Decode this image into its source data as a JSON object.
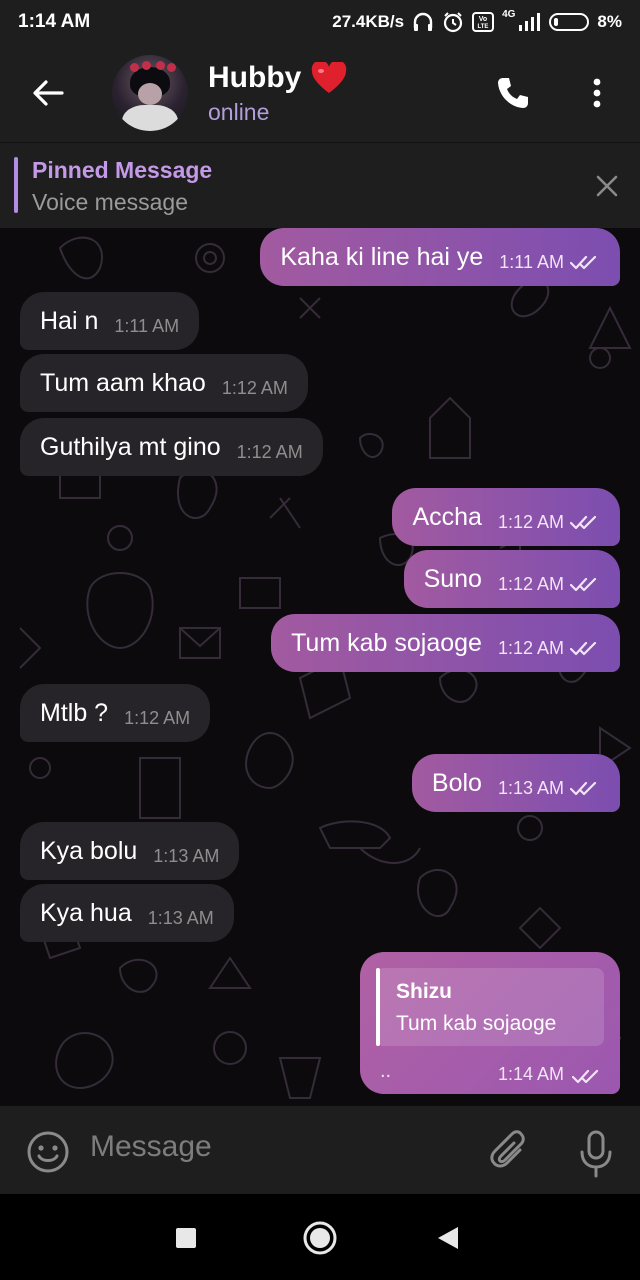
{
  "status_bar": {
    "time": "1:14 AM",
    "speed": "27.4KB/s",
    "battery": "8%",
    "network": "4G"
  },
  "header": {
    "title": "Hubby",
    "status": "online",
    "accent": "#b39ddb"
  },
  "pinned": {
    "label": "Pinned Message",
    "text": "Voice message"
  },
  "messages": [
    {
      "dir": "out",
      "text": "Kaha ki line hai ye",
      "time": "1:11 AM"
    },
    {
      "dir": "in",
      "text": "Hai n",
      "time": "1:11 AM"
    },
    {
      "dir": "in",
      "text": "Tum aam khao",
      "time": "1:12 AM"
    },
    {
      "dir": "in",
      "text": "Guthilya mt gino",
      "time": "1:12 AM"
    },
    {
      "dir": "out",
      "text": "Accha",
      "time": "1:12 AM"
    },
    {
      "dir": "out",
      "text": "Suno",
      "time": "1:12 AM"
    },
    {
      "dir": "out",
      "text": "Tum kab sojaoge",
      "time": "1:12 AM"
    },
    {
      "dir": "in",
      "text": "Mtlb ?",
      "time": "1:12 AM"
    },
    {
      "dir": "out",
      "text": "Bolo",
      "time": "1:13 AM"
    },
    {
      "dir": "in",
      "text": "Kya bolu",
      "time": "1:13 AM"
    },
    {
      "dir": "in",
      "text": "Kya hua",
      "time": "1:13 AM"
    }
  ],
  "reply_message": {
    "quoted_name": "Shizu",
    "quoted_text": "Tum kab sojaoge",
    "text": "..",
    "time": "1:14 AM"
  },
  "input": {
    "placeholder": "Message"
  },
  "colors": {
    "bubble_in": "#262428",
    "bubble_out_start": "#a25aa0",
    "bubble_out_end": "#7c4eb0",
    "panel": "#1e1e1e"
  }
}
